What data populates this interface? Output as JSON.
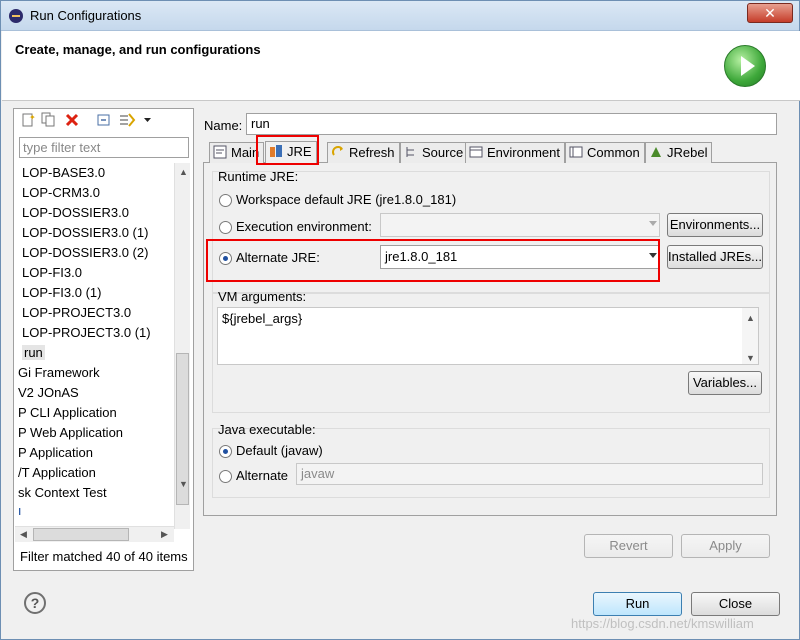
{
  "window": {
    "title": "Run Configurations",
    "close_glyph": "✕"
  },
  "banner": {
    "title": "Create, manage, and run configurations",
    "icon": "run-large-icon"
  },
  "left": {
    "toolbar_icons": [
      "new-config-icon",
      "duplicate-icon",
      "delete-icon",
      "collapse-all-icon",
      "filter-icon",
      "dropdown-icon"
    ],
    "filter_placeholder": "type filter text",
    "items": [
      "LOP-BASE3.0",
      "LOP-CRM3.0",
      "LOP-DOSSIER3.0",
      "LOP-DOSSIER3.0 (1)",
      "LOP-DOSSIER3.0 (2)",
      "LOP-FI3.0",
      "LOP-FI3.0 (1)",
      "LOP-PROJECT3.0",
      "LOP-PROJECT3.0 (1)",
      "run",
      "Gi Framework",
      "V2 JOnAS",
      "P CLI Application",
      "P Web Application",
      "P Application",
      "/T Application",
      "sk Context Test",
      "L"
    ],
    "selected": "run",
    "status": "Filter matched 40 of 40 items"
  },
  "right": {
    "name_label": "Name:",
    "name_value": "run",
    "tabs": [
      {
        "label": "Main",
        "icon": "main-icon"
      },
      {
        "label": "JRE",
        "icon": "jre-icon"
      },
      {
        "label": "Refresh",
        "icon": "refresh-icon"
      },
      {
        "label": "Source",
        "icon": "source-icon"
      },
      {
        "label": "Environment",
        "icon": "environment-icon"
      },
      {
        "label": "Common",
        "icon": "common-icon"
      },
      {
        "label": "JRebel",
        "icon": "jrebel-icon"
      }
    ],
    "active_tab": "JRE",
    "runtime_jre": {
      "title": "Runtime JRE:",
      "workspace_default": "Workspace default JRE (jre1.8.0_181)",
      "execution_env": "Execution environment:",
      "execution_env_value": "",
      "environments_button": "Environments...",
      "alternate": "Alternate JRE:",
      "alternate_value": "jre1.8.0_181",
      "installed_button": "Installed JREs...",
      "selected": "alternate"
    },
    "vm_args": {
      "title": "VM arguments:",
      "value": "${jrebel_args}",
      "variables_button": "Variables..."
    },
    "java_exec": {
      "title": "Java executable:",
      "default": "Default (javaw)",
      "alternate": "Alternate",
      "alternate_value": "javaw",
      "selected": "default"
    },
    "revert": "Revert",
    "apply": "Apply"
  },
  "footer": {
    "help_glyph": "?",
    "run": "Run",
    "close": "Close",
    "watermark": "https://blog.csdn.net/kmswilliam"
  }
}
